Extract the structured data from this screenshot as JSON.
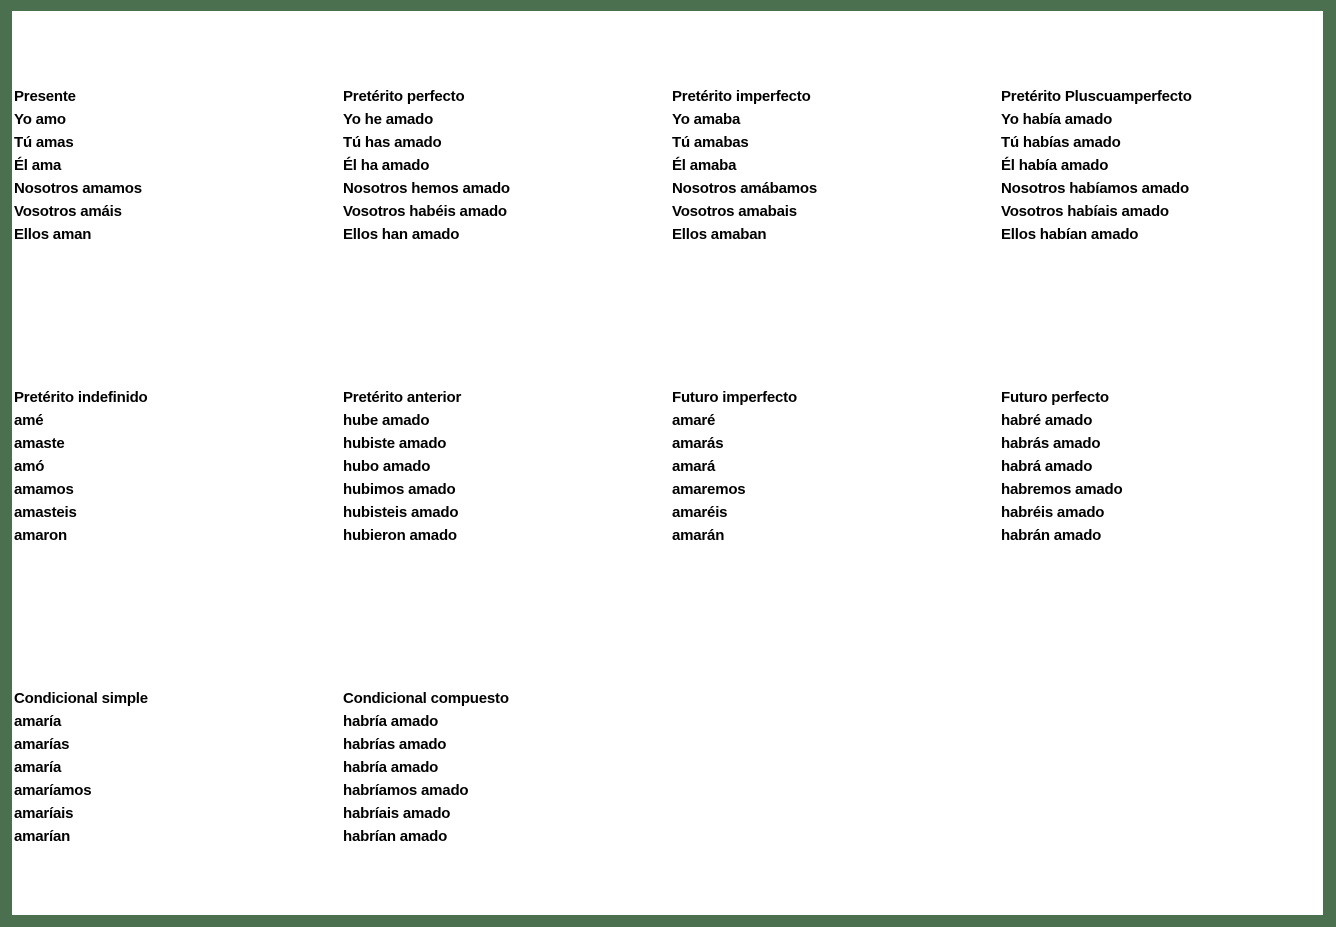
{
  "page": {
    "border_color": "#4a7050",
    "background_color": "#ffffff",
    "text_color": "#000000"
  },
  "blocks": [
    {
      "columns": [
        {
          "title": "Presente",
          "forms": [
            "Yo amo",
            "Tú amas",
            "Él ama",
            "Nosotros amamos",
            "Vosotros amáis",
            "Ellos aman"
          ]
        },
        {
          "title": "Pretérito perfecto",
          "forms": [
            "Yo he amado",
            "Tú has amado",
            "Él ha amado",
            "Nosotros hemos amado",
            "Vosotros habéis amado",
            "Ellos han amado"
          ]
        },
        {
          "title": "Pretérito imperfecto",
          "forms": [
            "Yo amaba",
            "Tú amabas",
            "Él amaba",
            "Nosotros amábamos",
            "Vosotros amabais",
            "Ellos amaban"
          ]
        },
        {
          "title": "Pretérito Pluscuamperfecto",
          "forms": [
            "Yo había amado",
            "Tú habías amado",
            "Él había amado",
            "Nosotros habíamos amado",
            "Vosotros habíais amado",
            "Ellos habían amado"
          ]
        }
      ]
    },
    {
      "columns": [
        {
          "title": "Pretérito indefinido",
          "forms": [
            "amé",
            "amaste",
            "amó",
            "amamos",
            "amasteis",
            "amaron"
          ]
        },
        {
          "title": "Pretérito anterior",
          "forms": [
            "hube amado",
            "hubiste amado",
            "hubo amado",
            "hubimos amado",
            "hubisteis amado",
            "hubieron amado"
          ]
        },
        {
          "title": "Futuro imperfecto",
          "forms": [
            "amaré",
            "amarás",
            "amará",
            "amaremos",
            "amaréis",
            "amarán"
          ]
        },
        {
          "title": "Futuro perfecto",
          "forms": [
            "habré amado",
            "habrás amado",
            "habrá amado",
            "habremos amado",
            "habréis amado",
            "habrán amado"
          ]
        }
      ]
    },
    {
      "columns": [
        {
          "title": "Condicional simple",
          "forms": [
            "amaría",
            "amarías",
            "amaría",
            "amaríamos",
            "amaríais",
            "amarían"
          ]
        },
        {
          "title": "Condicional compuesto",
          "forms": [
            "habría amado",
            "habrías amado",
            "habría amado",
            "habríamos amado",
            "habríais amado",
            "habrían amado"
          ]
        },
        {
          "title": "",
          "forms": []
        },
        {
          "title": "",
          "forms": []
        }
      ]
    }
  ]
}
